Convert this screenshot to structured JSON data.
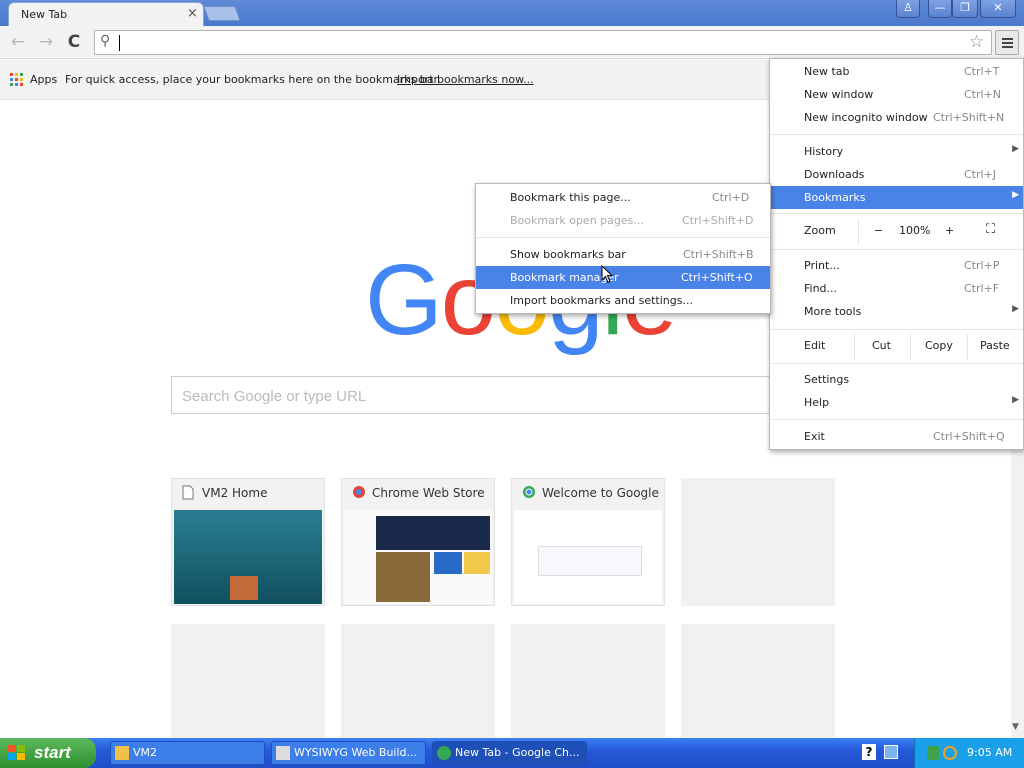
{
  "window": {
    "tab_title": "New Tab",
    "tab_close": "×",
    "btn_user": "♙",
    "btn_min": "—",
    "btn_max": "❐",
    "btn_close": "✕"
  },
  "toolbar": {
    "back": "←",
    "forward": "→",
    "reload": "C",
    "search_icon": "⚲",
    "star": "☆"
  },
  "bookmarks_bar": {
    "apps_label": "Apps",
    "hint": "For quick access, place your bookmarks here on the bookmarks bar.",
    "import_link": "Import bookmarks now..."
  },
  "content": {
    "logo_letters": [
      {
        "ch": "G",
        "color": "#4285f4"
      },
      {
        "ch": "o",
        "color": "#ea4335"
      },
      {
        "ch": "o",
        "color": "#fbbc05"
      },
      {
        "ch": "g",
        "color": "#4285f4"
      },
      {
        "ch": "l",
        "color": "#34a853"
      },
      {
        "ch": "e",
        "color": "#ea4335"
      }
    ],
    "search_placeholder": "Search Google or type URL",
    "tiles": [
      {
        "title": "VM2 Home"
      },
      {
        "title": "Chrome Web Store"
      },
      {
        "title": "Welcome to Google Chrome"
      }
    ]
  },
  "main_menu": {
    "new_tab": {
      "label": "New tab",
      "shortcut": "Ctrl+T"
    },
    "new_window": {
      "label": "New window",
      "shortcut": "Ctrl+N"
    },
    "new_incognito": {
      "label": "New incognito window",
      "shortcut": "Ctrl+Shift+N"
    },
    "history": {
      "label": "History"
    },
    "downloads": {
      "label": "Downloads",
      "shortcut": "Ctrl+J"
    },
    "bookmarks": {
      "label": "Bookmarks"
    },
    "zoom": {
      "label": "Zoom",
      "minus": "−",
      "value": "100%",
      "plus": "+",
      "fullscreen": "⛶"
    },
    "print": {
      "label": "Print...",
      "shortcut": "Ctrl+P"
    },
    "find": {
      "label": "Find...",
      "shortcut": "Ctrl+F"
    },
    "more_tools": {
      "label": "More tools"
    },
    "edit": {
      "label": "Edit",
      "cut": "Cut",
      "copy": "Copy",
      "paste": "Paste"
    },
    "settings": {
      "label": "Settings"
    },
    "help": {
      "label": "Help"
    },
    "exit": {
      "label": "Exit",
      "shortcut": "Ctrl+Shift+Q"
    }
  },
  "bookmarks_submenu": {
    "bookmark_page": {
      "label": "Bookmark this page...",
      "shortcut": "Ctrl+D"
    },
    "bookmark_open": {
      "label": "Bookmark open pages...",
      "shortcut": "Ctrl+Shift+D"
    },
    "show_bar": {
      "label": "Show bookmarks bar",
      "shortcut": "Ctrl+Shift+B"
    },
    "manager": {
      "label": "Bookmark manager",
      "shortcut": "Ctrl+Shift+O"
    },
    "import": {
      "label": "Import bookmarks and settings..."
    }
  },
  "taskbar": {
    "start": "start",
    "items": [
      {
        "label": "VM2"
      },
      {
        "label": "WYSIWYG Web Build..."
      },
      {
        "label": "New Tab - Google Ch..."
      }
    ],
    "help": "?",
    "clock": "9:05 AM"
  }
}
